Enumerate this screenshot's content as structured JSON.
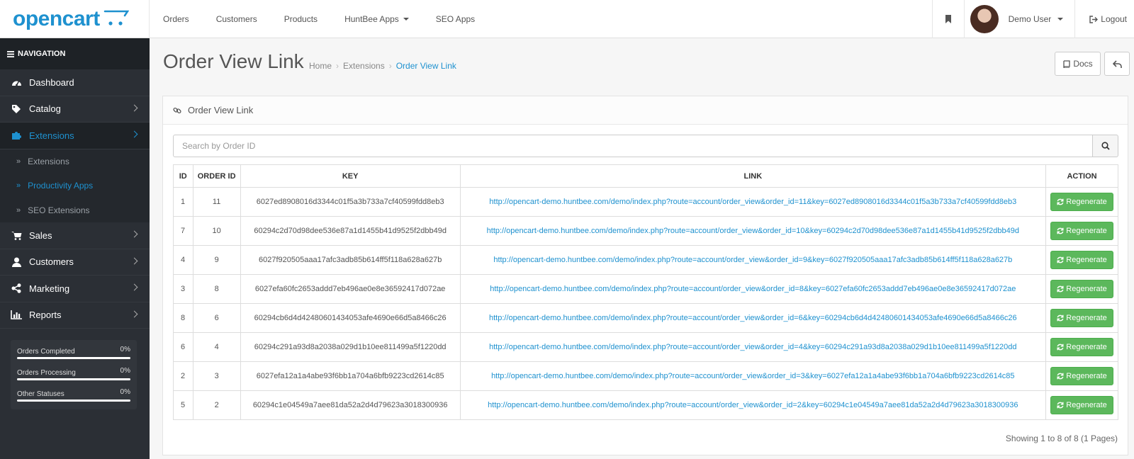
{
  "header": {
    "logo_text": "opencart",
    "nav": [
      {
        "label": "Orders",
        "dropdown": false
      },
      {
        "label": "Customers",
        "dropdown": false
      },
      {
        "label": "Products",
        "dropdown": false
      },
      {
        "label": "HuntBee Apps",
        "dropdown": true
      },
      {
        "label": "SEO Apps",
        "dropdown": false
      }
    ],
    "user_name": "Demo User",
    "logout_label": "Logout"
  },
  "sidebar": {
    "heading": "NAVIGATION",
    "items": [
      {
        "label": "Dashboard",
        "icon": "dashboard-icon",
        "active": false,
        "chevron": false
      },
      {
        "label": "Catalog",
        "icon": "tags-icon",
        "active": false,
        "chevron": true
      },
      {
        "label": "Extensions",
        "icon": "puzzle-icon",
        "active": true,
        "chevron": true,
        "children": [
          {
            "label": "Extensions",
            "active": false
          },
          {
            "label": "Productivity Apps",
            "active": true
          },
          {
            "label": "SEO Extensions",
            "active": false
          }
        ]
      },
      {
        "label": "Sales",
        "icon": "cart-icon",
        "active": false,
        "chevron": true
      },
      {
        "label": "Customers",
        "icon": "user-icon",
        "active": false,
        "chevron": true
      },
      {
        "label": "Marketing",
        "icon": "share-icon",
        "active": false,
        "chevron": true
      },
      {
        "label": "Reports",
        "icon": "bar-chart-icon",
        "active": false,
        "chevron": true
      }
    ],
    "stats": [
      {
        "label": "Orders Completed",
        "value": "0%",
        "percent": 0
      },
      {
        "label": "Orders Processing",
        "value": "0%",
        "percent": 0
      },
      {
        "label": "Other Statuses",
        "value": "0%",
        "percent": 0
      }
    ]
  },
  "page": {
    "title": "Order View Link",
    "breadcrumb": [
      "Home",
      "Extensions",
      "Order View Link"
    ],
    "docs_label": "Docs"
  },
  "panel": {
    "title": "Order View Link",
    "search_placeholder": "Search by Order ID",
    "columns": [
      "ID",
      "ORDER ID",
      "KEY",
      "LINK",
      "ACTION"
    ],
    "action_label": "Regenerate",
    "rows": [
      {
        "id": "1",
        "order_id": "11",
        "key": "6027ed8908016d3344c01f5a3b733a7cf40599fdd8eb3",
        "link": "http://opencart-demo.huntbee.com/demo/index.php?route=account/order_view&order_id=11&key=6027ed8908016d3344c01f5a3b733a7cf40599fdd8eb3"
      },
      {
        "id": "7",
        "order_id": "10",
        "key": "60294c2d70d98dee536e87a1d1455b41d9525f2dbb49d",
        "link": "http://opencart-demo.huntbee.com/demo/index.php?route=account/order_view&order_id=10&key=60294c2d70d98dee536e87a1d1455b41d9525f2dbb49d"
      },
      {
        "id": "4",
        "order_id": "9",
        "key": "6027f920505aaa17afc3adb85b614ff5f118a628a627b",
        "link": "http://opencart-demo.huntbee.com/demo/index.php?route=account/order_view&order_id=9&key=6027f920505aaa17afc3adb85b614ff5f118a628a627b"
      },
      {
        "id": "3",
        "order_id": "8",
        "key": "6027efa60fc2653addd7eb496ae0e8e36592417d072ae",
        "link": "http://opencart-demo.huntbee.com/demo/index.php?route=account/order_view&order_id=8&key=6027efa60fc2653addd7eb496ae0e8e36592417d072ae"
      },
      {
        "id": "8",
        "order_id": "6",
        "key": "60294cb6d4d42480601434053afe4690e66d5a8466c26",
        "link": "http://opencart-demo.huntbee.com/demo/index.php?route=account/order_view&order_id=6&key=60294cb6d4d42480601434053afe4690e66d5a8466c26"
      },
      {
        "id": "6",
        "order_id": "4",
        "key": "60294c291a93d8a2038a029d1b10ee811499a5f1220dd",
        "link": "http://opencart-demo.huntbee.com/demo/index.php?route=account/order_view&order_id=4&key=60294c291a93d8a2038a029d1b10ee811499a5f1220dd"
      },
      {
        "id": "2",
        "order_id": "3",
        "key": "6027efa12a1a4abe93f6bb1a704a6bfb9223cd2614c85",
        "link": "http://opencart-demo.huntbee.com/demo/index.php?route=account/order_view&order_id=3&key=6027efa12a1a4abe93f6bb1a704a6bfb9223cd2614c85"
      },
      {
        "id": "5",
        "order_id": "2",
        "key": "60294c1e04549a7aee81da52a2d4d79623a3018300936",
        "link": "http://opencart-demo.huntbee.com/demo/index.php?route=account/order_view&order_id=2&key=60294c1e04549a7aee81da52a2d4d79623a3018300936"
      }
    ],
    "pagination_text": "Showing 1 to 8 of 8 (1 Pages)"
  },
  "colors": {
    "accent": "#1e91cf",
    "sidebar": "#2b2f35",
    "success": "#5cb85c"
  }
}
